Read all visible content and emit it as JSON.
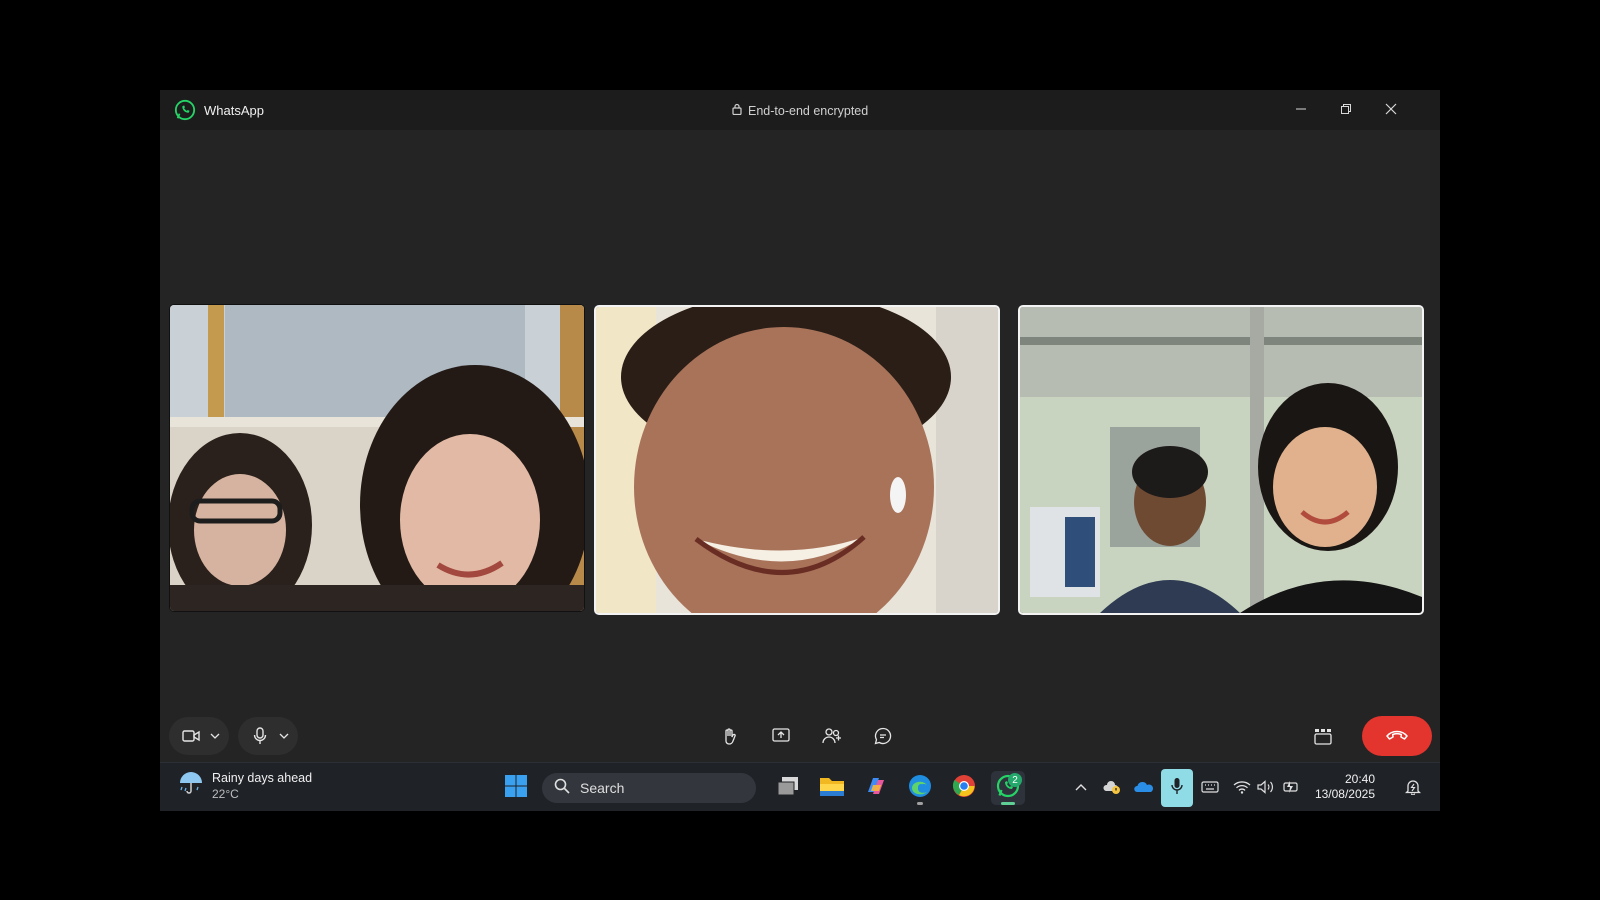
{
  "window": {
    "app_name": "WhatsApp",
    "encryption_label": "End-to-end encrypted"
  },
  "call": {
    "participants": [
      {
        "tile": "participant-tile-1",
        "description": "two people"
      },
      {
        "tile": "participant-tile-2",
        "description": "one person"
      },
      {
        "tile": "participant-tile-3",
        "description": "two people"
      }
    ]
  },
  "controls": {
    "left": [
      "video-icon",
      "chevron-down-icon",
      "microphone-icon",
      "chevron-down-icon"
    ],
    "center": [
      "raise-hand-icon",
      "share-screen-icon",
      "participants-icon",
      "chat-icon"
    ],
    "right": [
      "layout-icon",
      "end-call-icon"
    ]
  },
  "taskbar": {
    "weather_title": "Rainy days ahead",
    "weather_temp": "22°C",
    "search_placeholder": "Search",
    "whatsapp_badge": "2",
    "time": "20:40",
    "date": "13/08/2025"
  },
  "colors": {
    "accent_green": "#25d366",
    "end_call_red": "#e3352d",
    "mic_tray_highlight": "#8fdbe6"
  }
}
